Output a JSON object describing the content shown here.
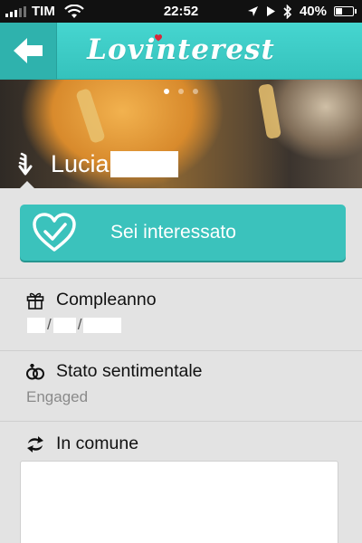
{
  "status_bar": {
    "carrier": "TIM",
    "time": "22:52",
    "battery": "40%",
    "battery_level": 0.4
  },
  "navbar": {
    "back_icon": "arrow-left-icon",
    "logo": "Lovinterest"
  },
  "profile": {
    "name": "Lucia",
    "photo_count": 3,
    "active_photo": 1
  },
  "interest_button": {
    "label": "Sei interessato",
    "icon": "heart-check-icon"
  },
  "sections": {
    "birthday": {
      "title": "Compleanno",
      "icon": "gift-icon",
      "separator": "/"
    },
    "relationship": {
      "title": "Stato sentimentale",
      "icon": "rings-icon",
      "value": "Engaged"
    },
    "common": {
      "title": "In comune",
      "icon": "sync-arrows-icon"
    }
  },
  "colors": {
    "accent": "#3bc2bc",
    "navbar": "#40cec8",
    "background": "#e3e3e3"
  }
}
